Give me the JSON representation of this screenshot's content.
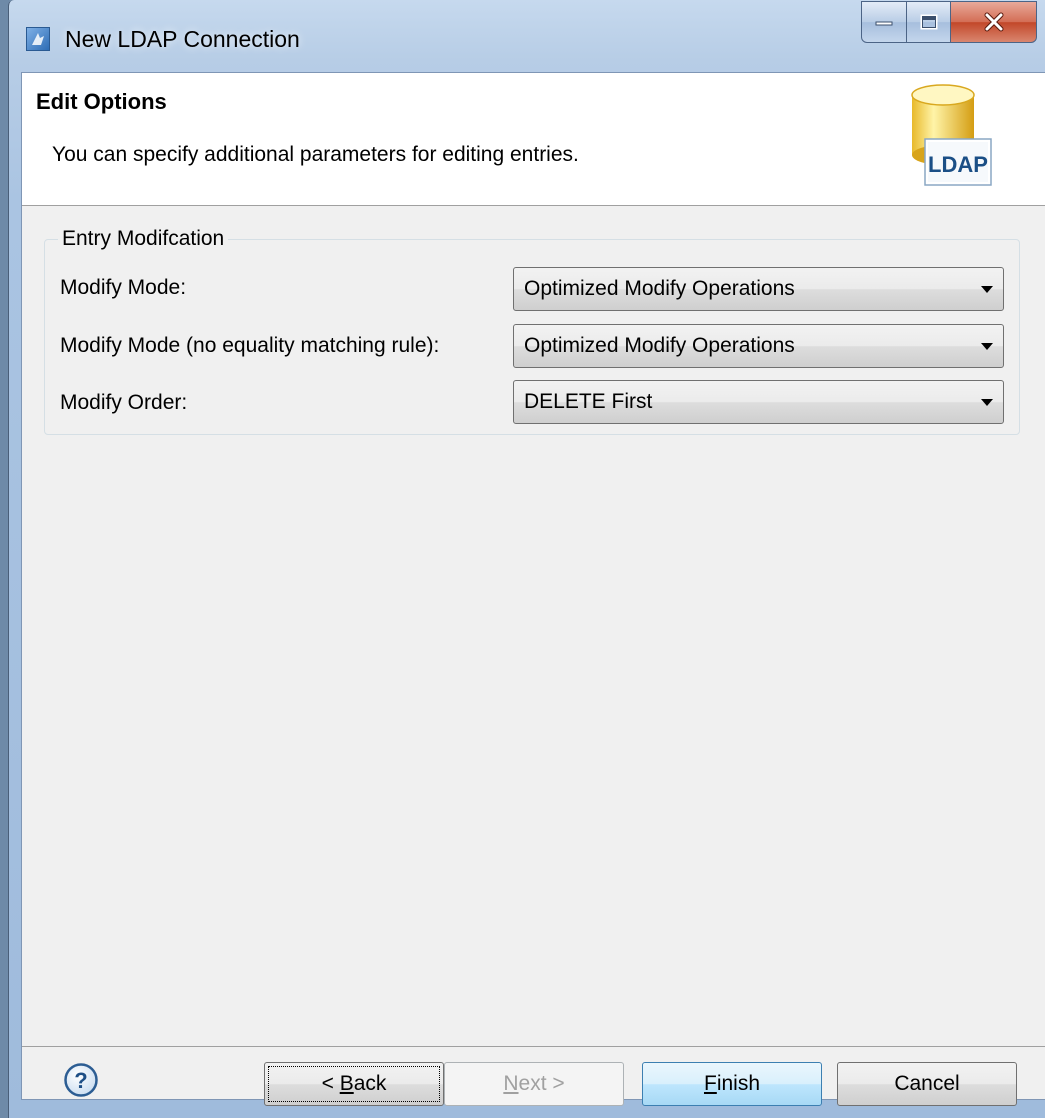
{
  "window": {
    "title": "New LDAP Connection"
  },
  "header": {
    "title": "Edit Options",
    "description": "You can specify additional parameters for editing entries.",
    "icon_label": "LDAP"
  },
  "group": {
    "title": "Entry Modifcation",
    "rows": [
      {
        "label": "Modify Mode:",
        "value": "Optimized Modify Operations"
      },
      {
        "label": "Modify Mode (no equality matching rule):",
        "value": "Optimized Modify Operations"
      },
      {
        "label": "Modify Order:",
        "value": "DELETE First"
      }
    ]
  },
  "buttons": {
    "back_prefix": "< ",
    "back_mnemonic": "B",
    "back_rest": "ack",
    "next_mnemonic": "N",
    "next_rest": "ext >",
    "finish_mnemonic": "F",
    "finish_rest": "inish",
    "cancel": "Cancel"
  },
  "colors": {
    "window_frame": "#aac4e2",
    "close_button": "#c24729",
    "default_button_border": "#3c7fb1"
  }
}
